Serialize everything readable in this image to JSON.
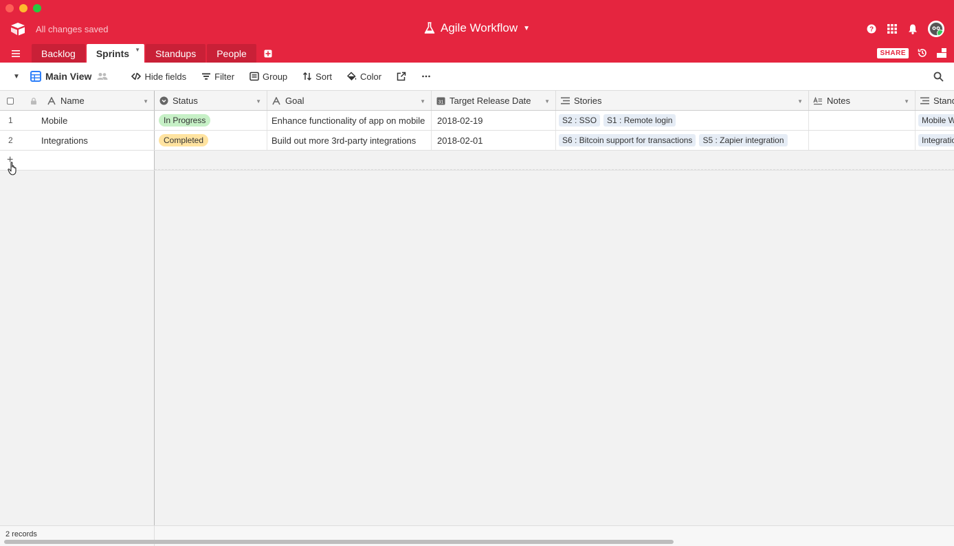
{
  "header": {
    "save_status": "All changes saved",
    "base_title": "Agile Workflow",
    "accent_color": "#e5253f"
  },
  "tabs": [
    {
      "label": "Backlog",
      "active": false
    },
    {
      "label": "Sprints",
      "active": true
    },
    {
      "label": "Standups",
      "active": false
    },
    {
      "label": "People",
      "active": false
    }
  ],
  "tab_actions": {
    "share_label": "SHARE"
  },
  "toolbar": {
    "view_name": "Main View",
    "hide_fields": "Hide fields",
    "filter": "Filter",
    "group": "Group",
    "sort": "Sort",
    "color": "Color"
  },
  "columns": {
    "name": "Name",
    "status": "Status",
    "goal": "Goal",
    "target_release_date": "Target Release Date",
    "stories": "Stories",
    "notes": "Notes",
    "standups": "Standups"
  },
  "rows": [
    {
      "num": "1",
      "name": "Mobile",
      "status": "In Progress",
      "goal": "Enhance functionality of app on mobile",
      "date": "2018-02-19",
      "stories": [
        "S2 : SSO",
        "S1 : Remote login"
      ],
      "standup": "Mobile W"
    },
    {
      "num": "2",
      "name": "Integrations",
      "status": "Completed",
      "goal": "Build out more 3rd-party integrations",
      "date": "2018-02-01",
      "stories": [
        "S6 : Bitcoin support for transactions",
        "S5 : Zapier integration"
      ],
      "standup": "Integratio"
    }
  ],
  "footer": {
    "record_count": "2 records"
  }
}
